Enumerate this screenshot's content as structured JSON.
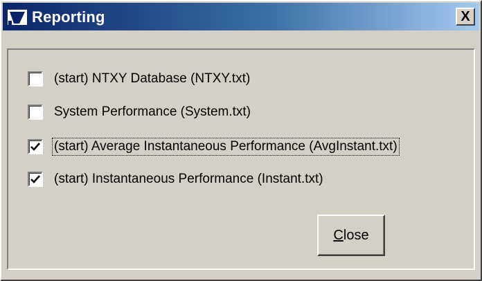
{
  "window": {
    "title": "Reporting",
    "close_glyph": "X",
    "title_icon": "reporting-app-icon"
  },
  "options": [
    {
      "label": "(start) NTXY Database (NTXY.txt)",
      "checked": false,
      "focused": false
    },
    {
      "label": "System Performance (System.txt)",
      "checked": false,
      "focused": false
    },
    {
      "label": "(start)  Average Instantaneous Performance (AvgInstant.txt)",
      "checked": true,
      "focused": true
    },
    {
      "label": "(start)  Instantaneous Performance (Instant.txt)",
      "checked": true,
      "focused": false
    }
  ],
  "close_button": {
    "mnemonic": "C",
    "rest": "lose"
  },
  "colors": {
    "title_gradient_start": "#0a246a",
    "title_gradient_end": "#a6caf0",
    "face": "#d4d0c8"
  }
}
